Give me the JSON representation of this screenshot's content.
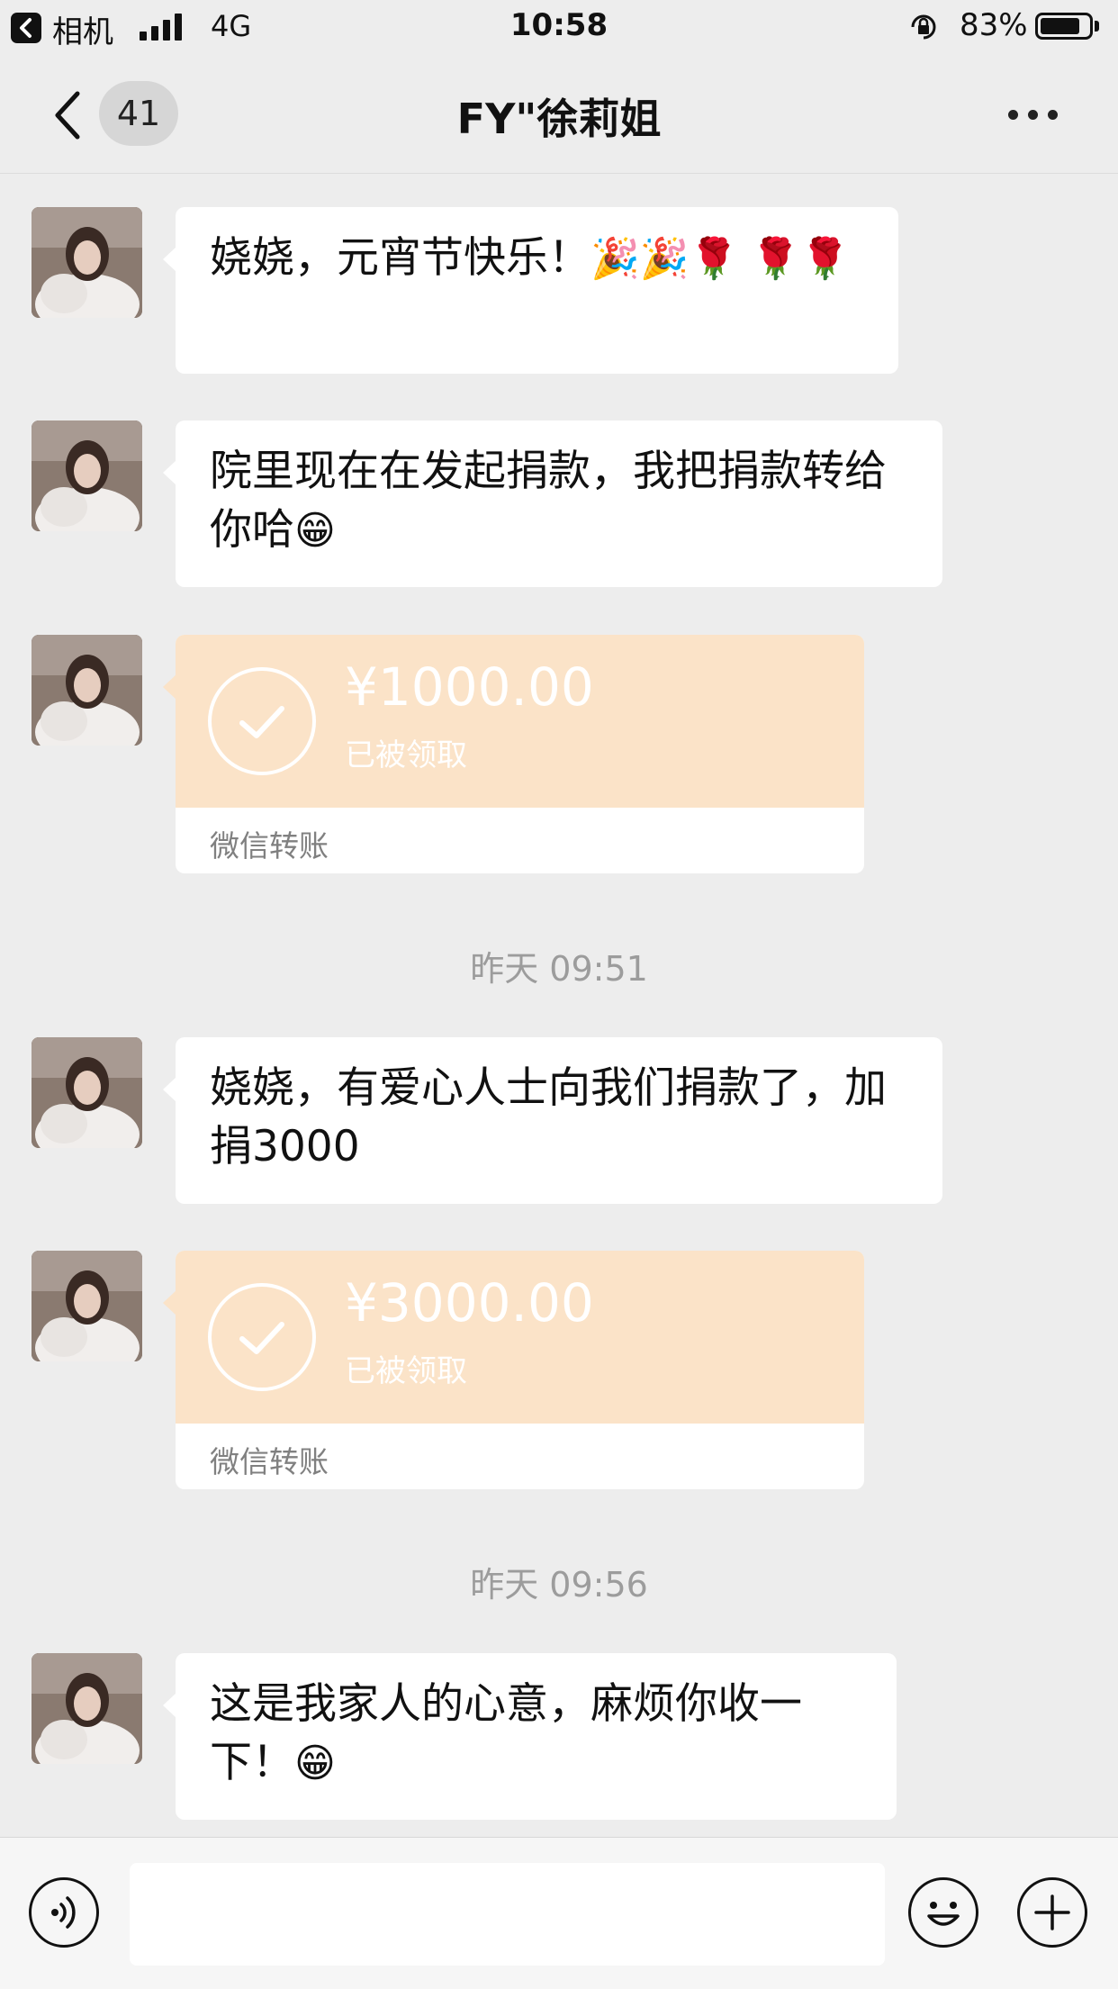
{
  "status_bar": {
    "back_app": "相机",
    "network": "4G",
    "time": "10:58",
    "battery": "83%",
    "battery_level": 0.83
  },
  "nav": {
    "unread_count": "41",
    "title": "FY\"徐莉姐"
  },
  "messages": [
    {
      "type": "text",
      "text": "娆娆，元宵节快乐！",
      "emoji": "🎉🎉🌹 🌹🌹"
    },
    {
      "type": "text",
      "text": "院里现在在发起捐款，我把捐款转给你哈",
      "emoji": "😁"
    },
    {
      "type": "transfer",
      "amount": "¥1000.00",
      "status": "已被领取",
      "label": "微信转账"
    },
    {
      "type": "time",
      "text": "昨天 09:51"
    },
    {
      "type": "text",
      "text": "娆娆，有爱心人士向我们捐款了，加捐3000"
    },
    {
      "type": "transfer",
      "amount": "¥3000.00",
      "status": "已被领取",
      "label": "微信转账"
    },
    {
      "type": "time",
      "text": "昨天 09:56"
    },
    {
      "type": "text",
      "text": "这是我家人的心意，麻烦你收一下！",
      "emoji": "😁"
    }
  ],
  "icons": {
    "back": "chevron-left-icon",
    "more": "more-dots-icon",
    "voice": "voice-icon",
    "emoji": "emoji-icon",
    "plus": "plus-icon",
    "check": "check-icon"
  },
  "colors": {
    "transfer_bg": "#fbe3c8",
    "chat_bg": "#ededed"
  }
}
